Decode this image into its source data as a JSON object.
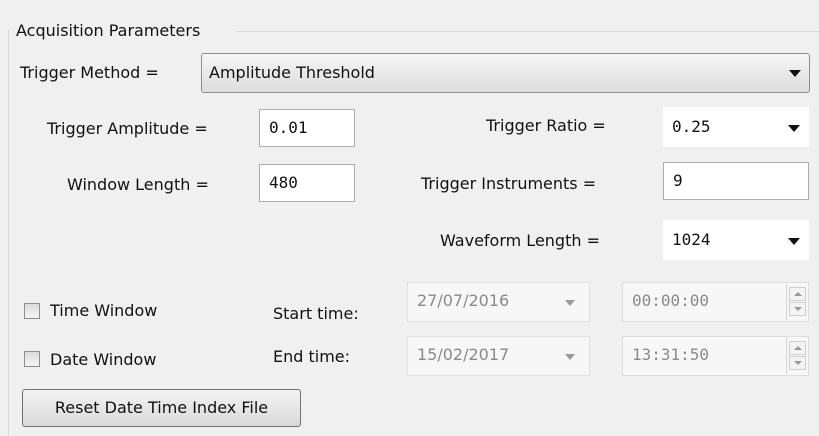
{
  "group": {
    "title": "Acquisition Parameters"
  },
  "trigger_method": {
    "label": "Trigger Method =",
    "value": "Amplitude Threshold"
  },
  "trigger_amplitude": {
    "label": "Trigger Amplitude =",
    "value": "0.01"
  },
  "trigger_ratio": {
    "label": "Trigger Ratio =",
    "value": "0.25"
  },
  "window_length": {
    "label": "Window Length =",
    "value": "480"
  },
  "trigger_instruments": {
    "label": "Trigger Instruments =",
    "value": "9"
  },
  "waveform_length": {
    "label": "Waveform Length =",
    "value": "1024"
  },
  "time_window": {
    "label": "Time Window",
    "checked": false
  },
  "date_window": {
    "label": "Date Window",
    "checked": false
  },
  "start": {
    "label": "Start time:",
    "date": "27/07/2016",
    "time": "00:00:00"
  },
  "end": {
    "label": "End time:",
    "date": "15/02/2017",
    "time": "13:31:50"
  },
  "reset_button": {
    "label": "Reset Date Time Index File"
  },
  "icons": {
    "dropdown": "chevron-down-icon",
    "spin_up": "spin-up-icon",
    "spin_down": "spin-down-icon",
    "checkbox": "checkbox-icon"
  },
  "colors": {
    "background": "#f0f0f0",
    "field_border": "#abadb3",
    "disabled_text": "#8a8a8a"
  }
}
